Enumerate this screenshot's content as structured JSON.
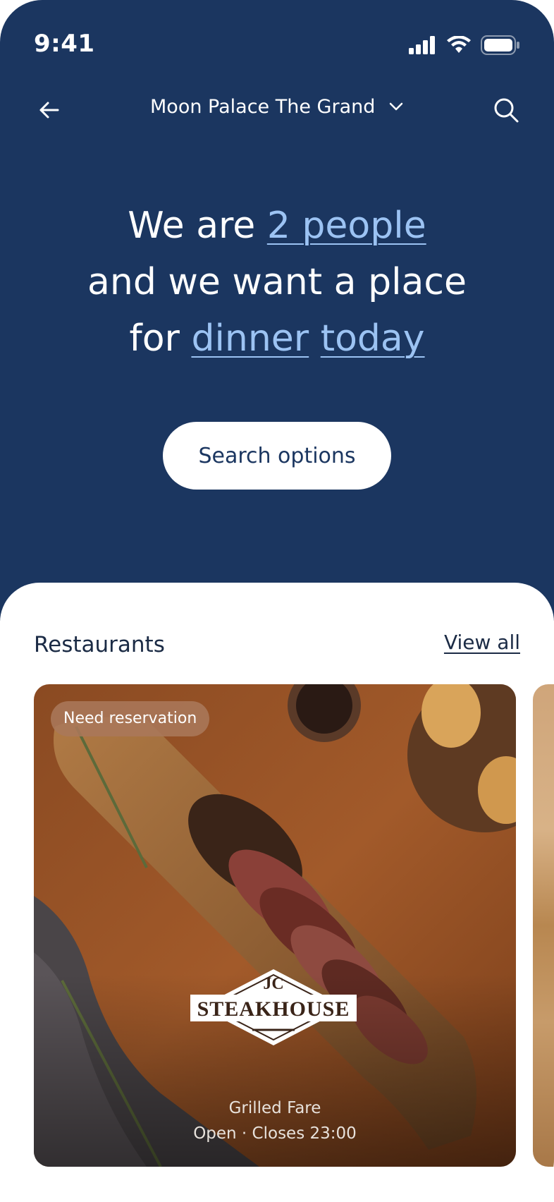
{
  "status_bar": {
    "time": "9:41"
  },
  "nav": {
    "location": "Moon Palace The Grand",
    "back_icon": "arrow-left-icon",
    "search_icon": "search-icon",
    "dropdown_icon": "chevron-down-icon"
  },
  "hero": {
    "line1_prefix": "We are ",
    "party_size": "2 people",
    "line2": "and we want a place",
    "line3_prefix": "for ",
    "meal": "dinner",
    "day": "today"
  },
  "search_button": "Search options",
  "restaurants": {
    "title": "Restaurants",
    "view_all": "View all",
    "cards": [
      {
        "badge": "Need reservation",
        "logo_small": "JC",
        "logo_text": "STEAKHOUSE",
        "cuisine": "Grilled Fare",
        "hours": "Open · Closes 23:00"
      }
    ]
  },
  "colors": {
    "header_bg": "#1b3660",
    "link": "#9cc3f3",
    "badge_bg": "#aa785a"
  }
}
